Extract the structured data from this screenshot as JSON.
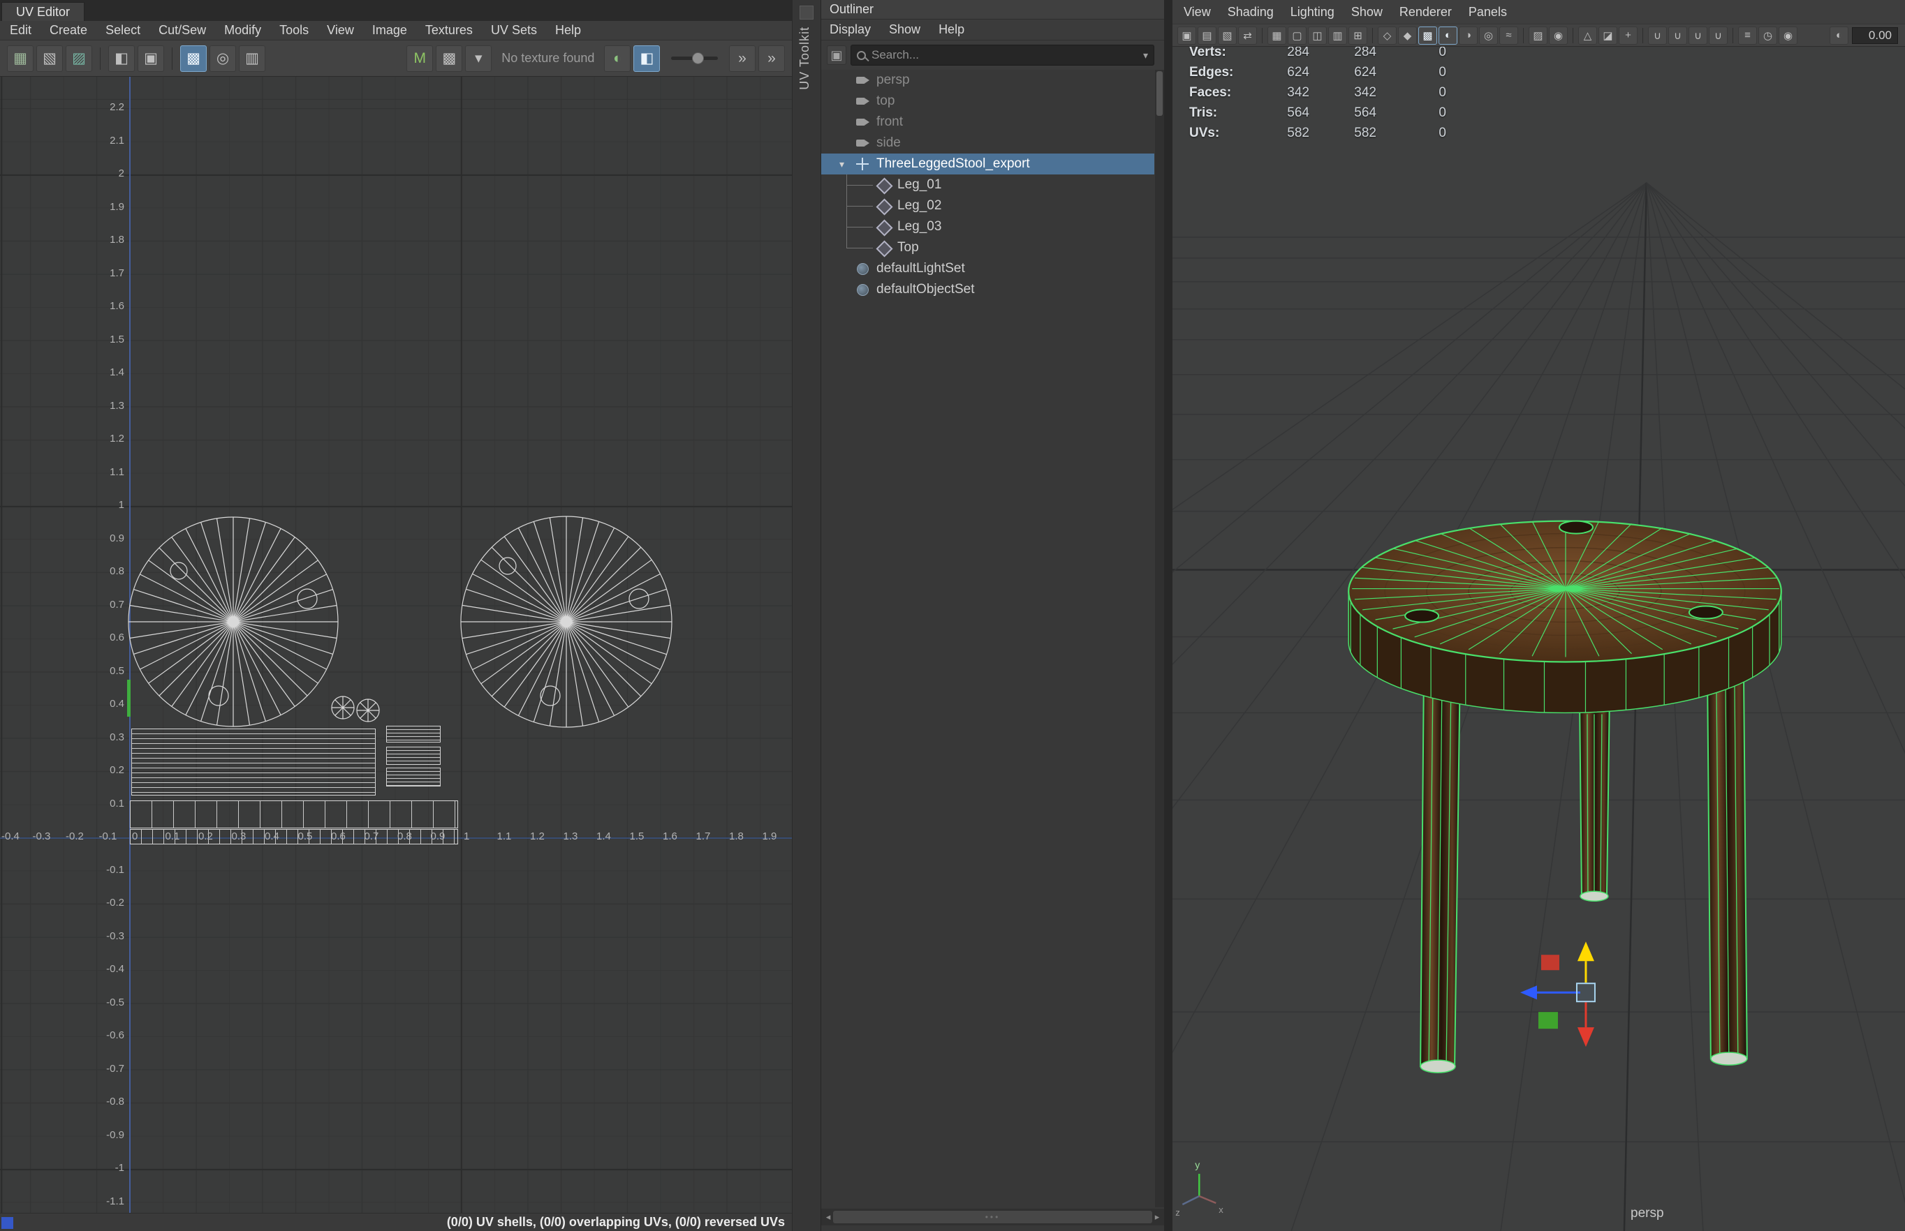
{
  "colors": {
    "selection-blue": "#4c7296",
    "wireframe-green": "#49e06b",
    "uv-line": "#d9d9d9",
    "axis-blue": "#4a66b0",
    "axis-green": "#3fae3f",
    "manip-yellow": "#ffd900",
    "manip-red": "#e23b2e",
    "manip-blue": "#2e5bff",
    "manip-green": "#3fa32d",
    "wood-top": "#6b4322",
    "wood-side": "#33200f"
  },
  "uv_editor": {
    "tab_label": "UV Editor",
    "menus": [
      "Edit",
      "Create",
      "Select",
      "Cut/Sew",
      "Modify",
      "Tools",
      "View",
      "Image",
      "Textures",
      "UV Sets",
      "Help"
    ],
    "toolbar": {
      "icons_a": [
        {
          "name": "uv-texture-checker-icon",
          "glyph": "▦",
          "color": "#9db89a"
        },
        {
          "name": "uv-shaded-shells-icon",
          "glyph": "▧"
        },
        {
          "name": "uv-distortion-icon",
          "glyph": "▨",
          "color": "#76b3a2"
        },
        "|",
        {
          "name": "display-shaded-uvs-icon",
          "glyph": "◧"
        },
        {
          "name": "texture-borders-icon",
          "glyph": "▣"
        },
        "|",
        {
          "name": "display-image-icon",
          "glyph": "▩",
          "active": true
        },
        {
          "name": "dim-image-icon",
          "glyph": "◎"
        },
        {
          "name": "uv-snapshot-icon",
          "glyph": "▥"
        }
      ],
      "icons_t": [
        {
          "name": "material-texture-icon",
          "glyph": "M",
          "color": "#8ec564"
        },
        {
          "name": "texture-swatch-icon",
          "glyph": "▩"
        },
        {
          "name": "texture-list-caret-icon",
          "glyph": "▾"
        }
      ],
      "texture_status": "No texture found",
      "icons_b": [
        {
          "name": "exposure-toggle-icon",
          "glyph": "◐",
          "color": "#8cc27f"
        },
        {
          "name": "gain-toggle-icon",
          "glyph": "◧",
          "active": true
        }
      ],
      "icons_c": [
        {
          "name": "toolbar-expand-icon",
          "glyph": "»"
        },
        {
          "name": "toolbar-overflow-icon",
          "glyph": "»"
        }
      ]
    },
    "axis": {
      "y_labels": [
        "2.2",
        "2.1",
        "2",
        "1.9",
        "1.8",
        "1.7",
        "1.6",
        "1.5",
        "1.4",
        "1.3",
        "1.2",
        "1.1",
        "1",
        "0.9",
        "0.8",
        "0.7",
        "0.6",
        "0.5",
        "0.4",
        "0.3",
        "0.2",
        "0.1",
        "-0.1",
        "-0.2",
        "-0.3",
        "-0.4",
        "-0.5",
        "-0.6",
        "-0.7",
        "-0.8",
        "-0.9",
        "-1",
        "-1.1"
      ],
      "x_labels": [
        "-0.4",
        "-0.3",
        "-0.2",
        "-0.1",
        "0",
        "0.1",
        "0.2",
        "0.3",
        "0.4",
        "0.5",
        "0.6",
        "0.7",
        "0.8",
        "0.9",
        "1",
        "1.1",
        "1.2",
        "1.3",
        "1.4",
        "1.5",
        "1.6",
        "1.7",
        "1.8",
        "1.9"
      ]
    },
    "status": "(0/0) UV shells, (0/0) overlapping UVs, (0/0) reversed UVs"
  },
  "uv_toolkit": {
    "label": "UV Toolkit"
  },
  "outliner": {
    "title": "Outliner",
    "menus": [
      "Display",
      "Show",
      "Help"
    ],
    "search_placeholder": "Search...",
    "items": [
      {
        "label": "persp",
        "icon": "camera",
        "depth": 1,
        "dim": true
      },
      {
        "label": "top",
        "icon": "camera",
        "depth": 1,
        "dim": true
      },
      {
        "label": "front",
        "icon": "camera",
        "depth": 1,
        "dim": true
      },
      {
        "label": "side",
        "icon": "camera",
        "depth": 1,
        "dim": true
      },
      {
        "label": "ThreeLeggedStool_export",
        "icon": "transform",
        "depth": 0,
        "selected": true,
        "expanded": true
      },
      {
        "label": "Leg_01",
        "icon": "mesh",
        "depth": 2,
        "stub": true
      },
      {
        "label": "Leg_02",
        "icon": "mesh",
        "depth": 2,
        "stub": true
      },
      {
        "label": "Leg_03",
        "icon": "mesh",
        "depth": 2,
        "stub": true
      },
      {
        "label": "Top",
        "icon": "mesh",
        "depth": 2,
        "stub": true
      },
      {
        "label": "defaultLightSet",
        "icon": "set",
        "depth": 1
      },
      {
        "label": "defaultObjectSet",
        "icon": "set",
        "depth": 1
      }
    ]
  },
  "viewport": {
    "menus": [
      "View",
      "Shading",
      "Lighting",
      "Show",
      "Renderer",
      "Panels"
    ],
    "toolbar_icons": [
      {
        "name": "camera-attributes-icon",
        "glyph": "▣"
      },
      {
        "name": "bookmarks-icon",
        "glyph": "▤"
      },
      {
        "name": "image-plane-icon",
        "glyph": "▧"
      },
      {
        "name": "pan-zoom-icon",
        "glyph": "⇄"
      },
      "|",
      {
        "name": "grid-display-icon",
        "glyph": "▦"
      },
      {
        "name": "film-gate-icon",
        "glyph": "▢"
      },
      {
        "name": "resolution-gate-icon",
        "glyph": "◫"
      },
      {
        "name": "gate-mask-icon",
        "glyph": "▥"
      },
      {
        "name": "field-chart-icon",
        "glyph": "⊞"
      },
      "|",
      {
        "name": "wireframe-display-icon",
        "glyph": "◇"
      },
      {
        "name": "smooth-shade-icon",
        "glyph": "◆"
      },
      {
        "name": "textured-display-icon",
        "glyph": "▩",
        "active": true
      },
      {
        "name": "use-all-lights-icon",
        "glyph": "◐",
        "active": true
      },
      {
        "name": "shadows-icon",
        "glyph": "◑"
      },
      {
        "name": "occlusion-icon",
        "glyph": "◎"
      },
      {
        "name": "motion-blur-icon",
        "glyph": "≈"
      },
      "|",
      {
        "name": "multisampling-icon",
        "glyph": "▨"
      },
      {
        "name": "depth-of-field-icon",
        "glyph": "◉"
      },
      "|",
      {
        "name": "isolate-select-icon",
        "glyph": "△"
      },
      {
        "name": "x-ray-icon",
        "glyph": "◪"
      },
      {
        "name": "x-ray-joints-icon",
        "glyph": "+"
      },
      "|",
      {
        "name": "snap-to-grids-icon",
        "glyph": "∪"
      },
      {
        "name": "snap-to-curves-icon",
        "glyph": "∪"
      },
      {
        "name": "snap-to-points-icon",
        "glyph": "∪"
      },
      {
        "name": "snap-to-planes-icon",
        "glyph": "∪"
      },
      "|",
      {
        "name": "input-operations-icon",
        "glyph": "≡"
      },
      {
        "name": "construction-history-icon",
        "glyph": "◷"
      },
      {
        "name": "render-view-icon",
        "glyph": "◉"
      }
    ],
    "exposure_icon": {
      "name": "exposure-icon",
      "glyph": "◐"
    },
    "exposure_value": "0.00",
    "hud_rows": [
      {
        "label": "Verts:",
        "current": "284",
        "total": "284",
        "extra": "0"
      },
      {
        "label": "Edges:",
        "current": "624",
        "total": "624",
        "extra": "0"
      },
      {
        "label": "Faces:",
        "current": "342",
        "total": "342",
        "extra": "0"
      },
      {
        "label": "Tris:",
        "current": "564",
        "total": "564",
        "extra": "0"
      },
      {
        "label": "UVs:",
        "current": "582",
        "total": "582",
        "extra": "0"
      }
    ],
    "camera_label": "persp",
    "axis_triad": {
      "x": "x",
      "y": "y",
      "z": "z"
    }
  }
}
